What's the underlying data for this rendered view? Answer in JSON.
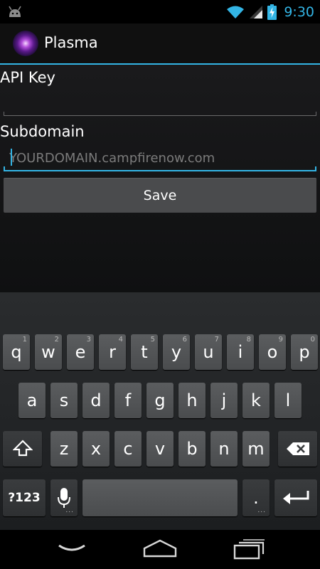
{
  "status_bar": {
    "time": "9:30",
    "accent_color": "#33b5e5",
    "icons": [
      "android-icon",
      "wifi-icon",
      "signal-icon",
      "battery-charging-icon"
    ]
  },
  "action_bar": {
    "title": "Plasma",
    "icon": "plasma-ball-app-icon"
  },
  "form": {
    "api_key_label": "API Key",
    "api_key_value": "",
    "subdomain_label": "Subdomain",
    "subdomain_placeholder": "YOURDOMAIN.campfirenow.com",
    "save_label": "Save"
  },
  "keyboard": {
    "row1": [
      {
        "label": "q",
        "num": "1"
      },
      {
        "label": "w",
        "num": "2"
      },
      {
        "label": "e",
        "num": "3"
      },
      {
        "label": "r",
        "num": "4"
      },
      {
        "label": "t",
        "num": "5"
      },
      {
        "label": "y",
        "num": "6"
      },
      {
        "label": "u",
        "num": "7"
      },
      {
        "label": "i",
        "num": "8"
      },
      {
        "label": "o",
        "num": "9"
      },
      {
        "label": "p",
        "num": "0"
      }
    ],
    "row2": [
      "a",
      "s",
      "d",
      "f",
      "g",
      "h",
      "j",
      "k",
      "l"
    ],
    "row3": [
      "z",
      "x",
      "c",
      "v",
      "b",
      "n",
      "m"
    ],
    "symbols_label": "?123",
    "period_label": ".",
    "dots": "..."
  },
  "navigation": {
    "icons": [
      "back-icon",
      "home-icon",
      "recent-apps-icon"
    ]
  }
}
